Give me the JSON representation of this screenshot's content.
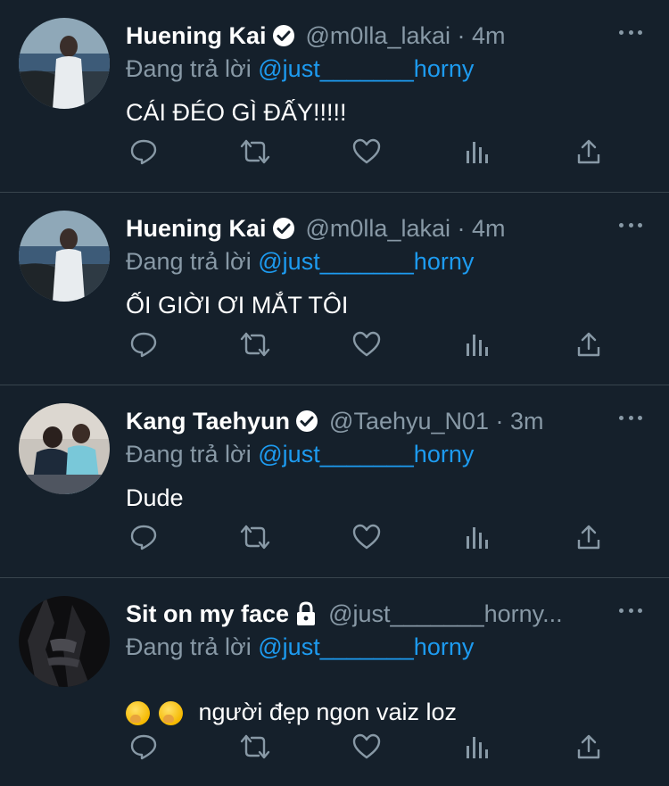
{
  "tweets": [
    {
      "display_name": "Huening Kai",
      "verified": true,
      "locked": false,
      "handle": "@m0lla_lakai · 4m",
      "reply_prefix": "Đang trả lời ",
      "reply_to": "@just_______horny",
      "text": "CÁI ĐÉO GÌ ĐẤY!!!!!",
      "emojis": 0
    },
    {
      "display_name": "Huening Kai",
      "verified": true,
      "locked": false,
      "handle": "@m0lla_lakai · 4m",
      "reply_prefix": "Đang trả lời ",
      "reply_to": "@just_______horny",
      "text": "ỐI GIỜI ƠI MẮT TÔI",
      "emojis": 0
    },
    {
      "display_name": "Kang Taehyun",
      "verified": true,
      "locked": false,
      "handle": "@Taehyu_N01 · 3m",
      "reply_prefix": "Đang trả lời ",
      "reply_to": "@just_______horny",
      "text": "Dude",
      "emojis": 0
    },
    {
      "display_name": "Sit on my face",
      "verified": false,
      "locked": true,
      "handle": "@just_______horny...",
      "reply_prefix": "Đang trả lời ",
      "reply_to": "@just_______horny",
      "text": "người đẹp ngon vaiz loz",
      "emojis": 2
    }
  ],
  "icons": {
    "reply": "reply-icon",
    "retweet": "retweet-icon",
    "like": "like-icon",
    "analytics": "analytics-icon",
    "share": "share-icon",
    "more": "more-icon",
    "verified": "verified-badge-icon",
    "lock": "lock-icon"
  },
  "colors": {
    "background": "#15202b",
    "divider": "#38444d",
    "secondary_text": "#8899a6",
    "link": "#1d9bf0"
  }
}
